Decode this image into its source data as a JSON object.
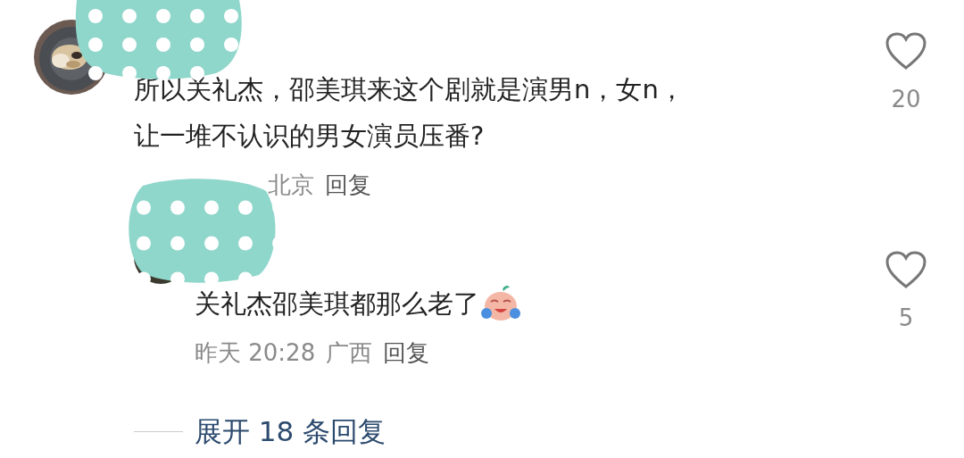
{
  "comment": {
    "text": "所以关礼杰，邵美琪来这个剧就是演男n，女n，让一堆不认识的男女演员压番?",
    "location": "北京",
    "reply_action": "回复",
    "liked": false,
    "likes": "20"
  },
  "reply": {
    "text": "关礼杰邵美琪都那么老了",
    "time": "昨天 20:28",
    "location": "广西",
    "reply_action": "回复",
    "liked": false,
    "likes": "5"
  },
  "expand": {
    "label": "展开 18 条回复"
  }
}
